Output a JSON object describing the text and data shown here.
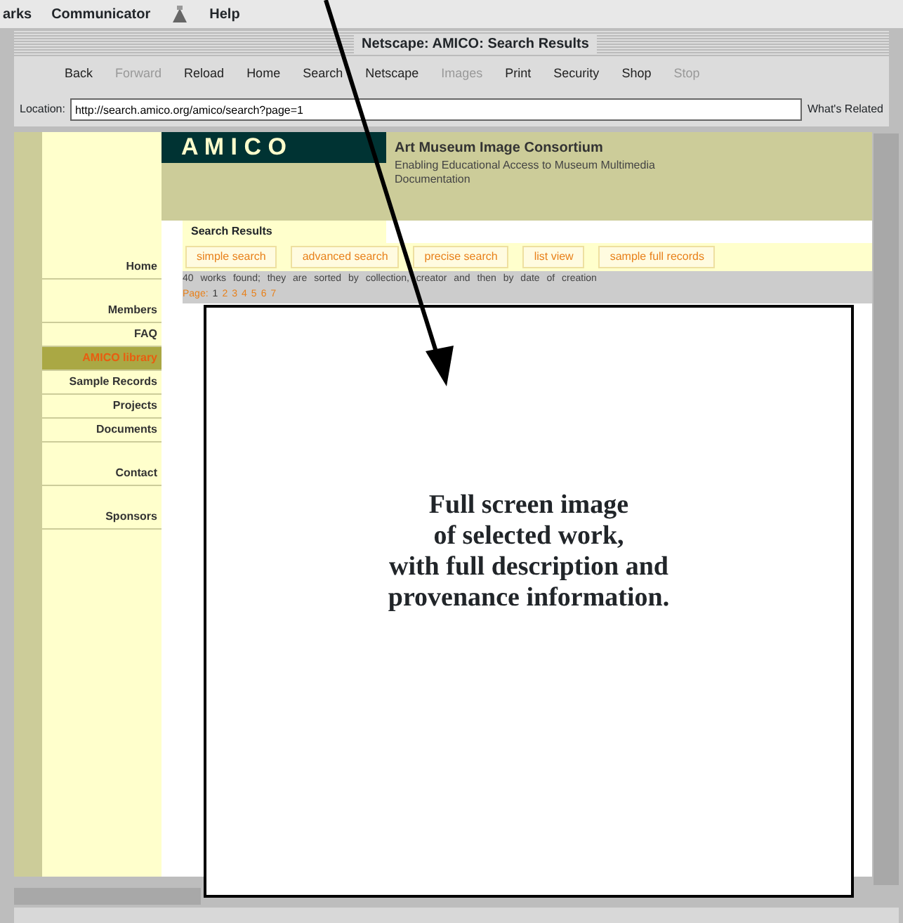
{
  "menu_bar": {
    "items": [
      "arks",
      "Communicator",
      "Help"
    ]
  },
  "window": {
    "title": "Netscape: AMICO: Search Results"
  },
  "toolbar": [
    {
      "label": "Back",
      "disabled": false
    },
    {
      "label": "Forward",
      "disabled": true
    },
    {
      "label": "Reload",
      "disabled": false
    },
    {
      "label": "Home",
      "disabled": false
    },
    {
      "label": "Search",
      "disabled": false
    },
    {
      "label": "Netscape",
      "disabled": false
    },
    {
      "label": "Images",
      "disabled": true
    },
    {
      "label": "Print",
      "disabled": false
    },
    {
      "label": "Security",
      "disabled": false
    },
    {
      "label": "Shop",
      "disabled": false
    },
    {
      "label": "Stop",
      "disabled": true
    }
  ],
  "location": {
    "label": "Location:",
    "value": "http://search.amico.org/amico/search?page=1",
    "related": "What's Related"
  },
  "site": {
    "logo": "A M I C O",
    "name": "Art Museum Image Consortium",
    "tagline": "Enabling Educational Access to Museum Multimedia Documentation",
    "sidebar": [
      {
        "label": "Home",
        "selected": false,
        "gap_before": false
      },
      {
        "label": "Members",
        "selected": false,
        "gap_before": true
      },
      {
        "label": "FAQ",
        "selected": false,
        "gap_before": false
      },
      {
        "label": "AMICO library",
        "selected": true,
        "gap_before": false
      },
      {
        "label": "Sample Records",
        "selected": false,
        "gap_before": false
      },
      {
        "label": "Projects",
        "selected": false,
        "gap_before": false
      },
      {
        "label": "Documents",
        "selected": false,
        "gap_before": false
      },
      {
        "label": "Contact",
        "selected": false,
        "gap_before": true
      },
      {
        "label": "Sponsors",
        "selected": false,
        "gap_before": true
      }
    ],
    "section_title": "Search Results",
    "tabs": [
      {
        "label": "simple search"
      },
      {
        "label": "advanced search"
      },
      {
        "label": "precise search"
      },
      {
        "label": "list view"
      },
      {
        "label": "sample full records"
      }
    ],
    "summary": "40 works found; they are sorted by collection, creator and then by date of creation",
    "pages_label": "Page:",
    "pages": [
      {
        "label": "1",
        "selected": true
      },
      {
        "label": "2",
        "selected": false
      },
      {
        "label": "3",
        "selected": false
      },
      {
        "label": "4",
        "selected": false
      },
      {
        "label": "5",
        "selected": false
      },
      {
        "label": "6",
        "selected": false
      },
      {
        "label": "7",
        "selected": false
      }
    ]
  },
  "annotation": {
    "lines": [
      "Full screen image",
      "of selected work,",
      "with full description and",
      "provenance information."
    ]
  }
}
